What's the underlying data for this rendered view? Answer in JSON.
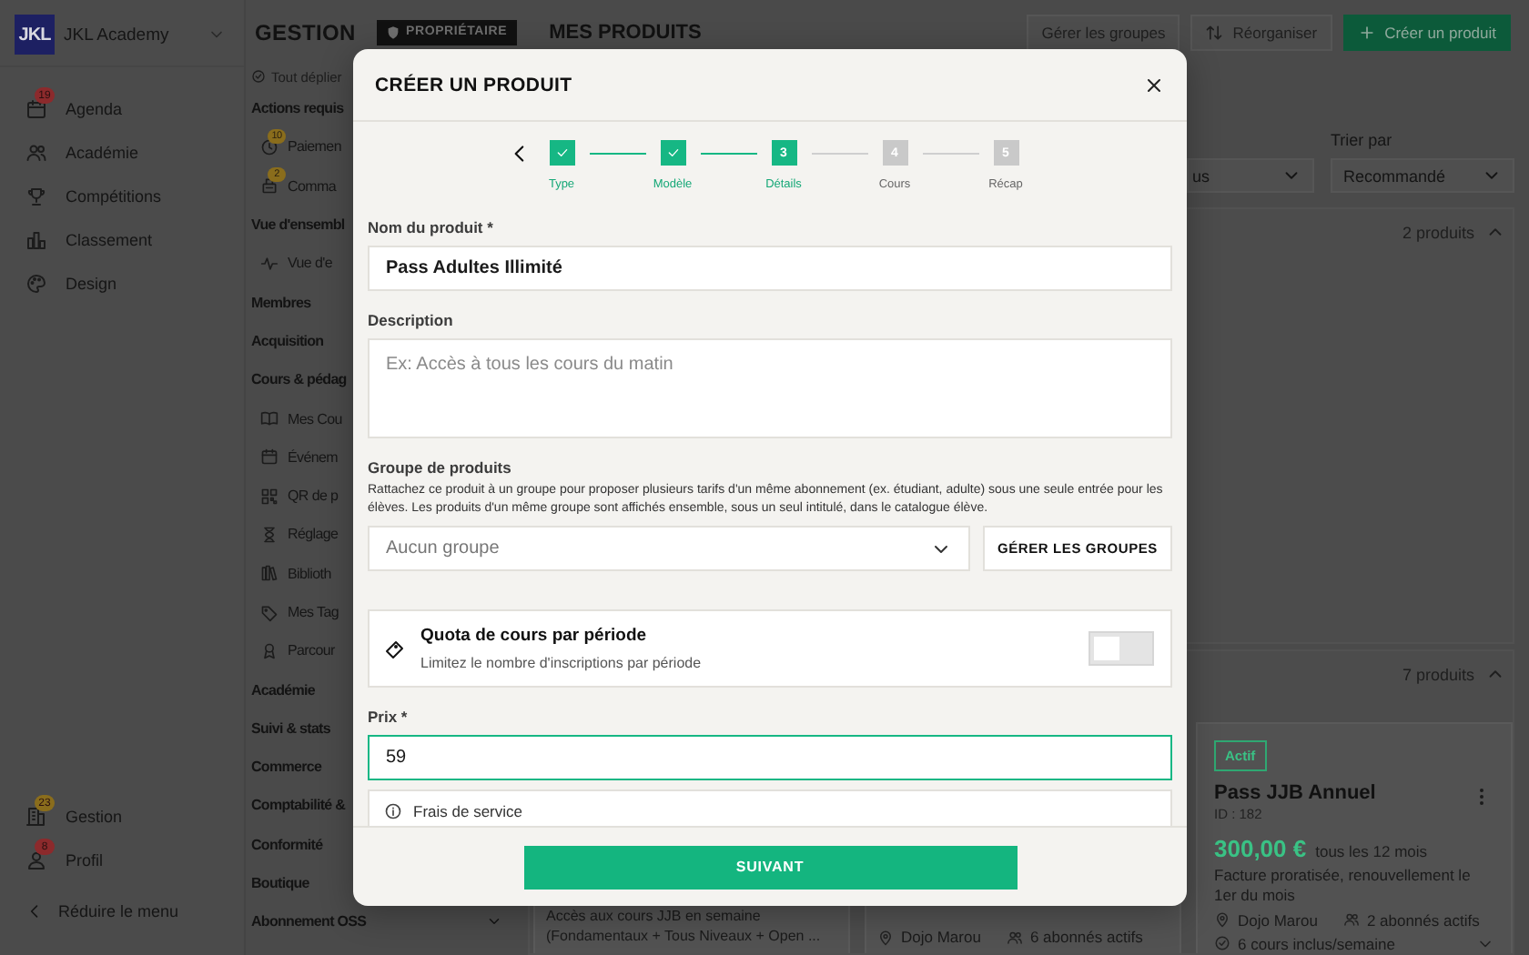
{
  "sidebar": {
    "logo": "JKL",
    "org_name": "JKL Academy",
    "items": [
      {
        "label": "Agenda",
        "badge": {
          "text": "19",
          "color": "#8c2a2c"
        }
      },
      {
        "label": "Académie"
      },
      {
        "label": "Compétitions"
      },
      {
        "label": "Classement"
      },
      {
        "label": "Design"
      }
    ],
    "bottom_items": [
      {
        "label": "Gestion",
        "badge": {
          "text": "23",
          "color": "#8a6d1c"
        }
      },
      {
        "label": "Profil",
        "badge": {
          "text": "8",
          "color": "#8c2a2c"
        }
      }
    ],
    "collapse": "Réduire le menu"
  },
  "header": {
    "section": "GESTION",
    "role_badge": "PROPRIÉTAIRE",
    "title": "MES PRODUITS",
    "actions": [
      {
        "label": "Gérer les groupes",
        "kind": "secondary"
      },
      {
        "label": "Réorganiser",
        "kind": "secondary"
      },
      {
        "label": "Créer un produit",
        "kind": "primary"
      }
    ]
  },
  "nav": {
    "expand_all": "Tout déplier",
    "sections": [
      {
        "title": "Actions requis",
        "items": [
          {
            "label": "Paiemen",
            "badge": {
              "text": "10",
              "color": "#8a6d1c"
            }
          },
          {
            "label": "Comma",
            "badge": {
              "text": "2",
              "color": "#8a6d1c"
            }
          }
        ]
      },
      {
        "title": "Vue d'ensembl",
        "items": [
          {
            "label": "Vue d'e"
          }
        ]
      },
      {
        "title": "Membres"
      },
      {
        "title": "Acquisition"
      },
      {
        "title": "Cours & pédag",
        "items": [
          {
            "label": "Mes Cou"
          },
          {
            "label": "Événem"
          },
          {
            "label": "QR de p"
          },
          {
            "label": "Réglage"
          },
          {
            "label": "Biblioth"
          },
          {
            "label": "Mes Tag"
          },
          {
            "label": "Parcour"
          }
        ]
      },
      {
        "title": "Académie"
      },
      {
        "title": "Suivi & stats"
      },
      {
        "title": "Commerce"
      },
      {
        "title": "Comptabilité &"
      },
      {
        "title": "Conformité"
      },
      {
        "title": "Boutique"
      },
      {
        "title": "Abonnement OSS",
        "expanded": false
      }
    ]
  },
  "filters": [
    {
      "value": "us"
    },
    {
      "label": "Trier par",
      "value": "Recommandé"
    }
  ],
  "groups": [
    {
      "count": "2 produits",
      "expanded": true
    },
    {
      "count": "7 produits",
      "expanded": true,
      "products": [
        {
          "kind": "partial",
          "description": "Accès aux cours JJB en semaine (Fondamentaux + Tous Niveaux + Open ..."
        },
        {
          "kind": "partial",
          "location": "Dojo Marou",
          "subscribers": "6 abonnés actifs"
        },
        {
          "kind": "full",
          "status": "Actif",
          "name": "Pass JJB Annuel",
          "id": "ID : 182",
          "price": "300,00 €",
          "period": "tous les 12 mois",
          "description": "Facture proratisée, renouvellement le 1er du mois",
          "location": "Dojo Marou",
          "subscribers": "2 abonnés actifs",
          "courses": "6 cours inclus/semaine"
        }
      ]
    }
  ],
  "modal": {
    "title": "CRÉER UN PRODUIT",
    "steps": [
      {
        "label": "Type",
        "done": true,
        "selected": false
      },
      {
        "label": "Modèle",
        "done": true,
        "selected": false
      },
      {
        "label": "Détails",
        "number": "3",
        "done": false,
        "selected": true
      },
      {
        "label": "Cours",
        "number": "4",
        "done": false,
        "selected": false
      },
      {
        "label": "Récap",
        "number": "5",
        "done": false,
        "selected": false
      }
    ],
    "name": {
      "label": "Nom du produit *",
      "value": "Pass Adultes Illimité"
    },
    "description": {
      "label": "Description",
      "placeholder": "Ex: Accès à tous les cours du matin"
    },
    "group": {
      "label": "Groupe de produits",
      "help": "Rattachez ce produit à un groupe pour proposer plusieurs tarifs d'un même abonnement (ex. étudiant, adulte) sous une seule entrée pour les élèves. Les produits d'un même groupe sont affichés ensemble, sous un seul intitulé, dans le catalogue élève.",
      "placeholder": "Aucun groupe",
      "manage_button": "GÉRER LES GROUPES"
    },
    "quota": {
      "title": "Quota de cours par période",
      "subtitle": "Limitez le nombre d'inscriptions par période",
      "on": false
    },
    "price": {
      "label": "Prix *",
      "value": "59",
      "focused": true
    },
    "service_fee": {
      "label": "Frais de service"
    },
    "next_button": "SUIVANT"
  }
}
